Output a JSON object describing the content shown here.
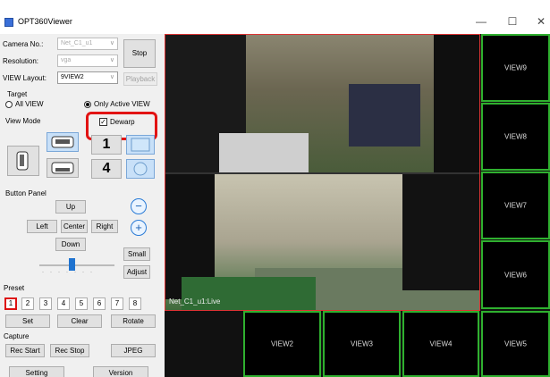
{
  "window": {
    "title": "OPT360Viewer",
    "minimize": "—",
    "maximize": "☐",
    "close": "✕"
  },
  "camera": {
    "camera_label": "Camera No.:",
    "camera_value": "Net_C1_u1",
    "resolution_label": "Resolution:",
    "resolution_value": "vga",
    "layout_label": "VIEW Layout:",
    "layout_value": "9VIEW2",
    "stop": "Stop",
    "playback": "Playback"
  },
  "target": {
    "title": "Target",
    "all_view": "All VIEW",
    "only_active": "Only Active VIEW"
  },
  "view_mode": {
    "title": "View Mode",
    "dewarp": "Dewarp",
    "one": "1",
    "four": "4"
  },
  "button_panel": {
    "title": "Button Panel",
    "up": "Up",
    "left": "Left",
    "center": "Center",
    "right": "Right",
    "down": "Down",
    "small": "Small",
    "adjust": "Adjust",
    "zoom_out": "−",
    "zoom_in": "+"
  },
  "preset": {
    "title": "Preset",
    "numbers": [
      "1",
      "2",
      "3",
      "4",
      "5",
      "6",
      "7",
      "8"
    ],
    "set": "Set",
    "clear": "Clear",
    "rotate": "Rotate"
  },
  "capture": {
    "title": "Capture",
    "rec_start": "Rec Start",
    "rec_stop": "Rec Stop",
    "jpeg": "JPEG",
    "setting": "Setting",
    "version": "Version"
  },
  "video": {
    "main_label": "Net_C1_u1:Live",
    "views": {
      "v9": "VIEW9",
      "v8": "VIEW8",
      "v7": "VIEW7",
      "v6": "VIEW6",
      "v5": "VIEW5",
      "v4": "VIEW4",
      "v3": "VIEW3",
      "v2": "VIEW2"
    }
  },
  "colors": {
    "accent": "#2fb02f",
    "highlight": "#e21313",
    "active_border": "#d33"
  }
}
